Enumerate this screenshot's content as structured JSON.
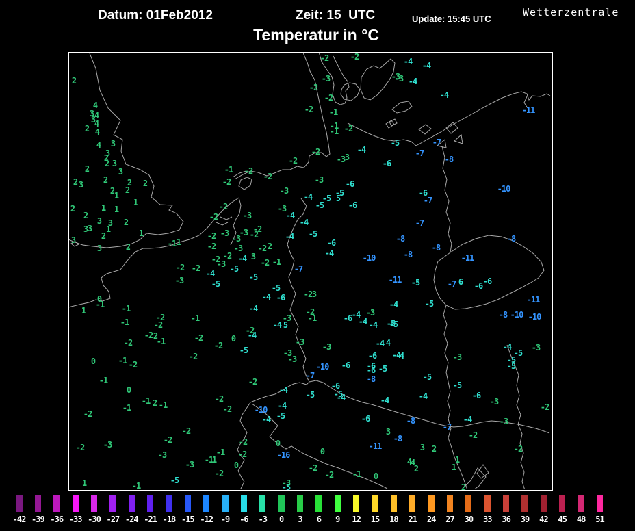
{
  "header": {
    "datum": "Datum: 01Feb2012",
    "zeit": "Zeit: 15  UTC",
    "update": "Update: 15:45 UTC",
    "brand": "Wetterzentrale",
    "title": "Temperatur in °C"
  },
  "map": {
    "colors": {
      "g": "#30c878",
      "c": "#30e0d0",
      "b": "#3494ff"
    },
    "stations": [
      [
        "2",
        108,
        118
      ],
      [
        "4",
        139,
        154
      ],
      [
        "3",
        134,
        166
      ],
      [
        "4",
        141,
        169
      ],
      [
        "3",
        136,
        175
      ],
      [
        "4",
        141,
        181
      ],
      [
        "2",
        127,
        188
      ],
      [
        "4",
        142,
        193
      ],
      [
        "4",
        144,
        212
      ],
      [
        "3",
        165,
        210
      ],
      [
        "3",
        157,
        224
      ],
      [
        "2",
        155,
        231
      ],
      [
        "2",
        156,
        239
      ],
      [
        "3",
        167,
        239
      ],
      [
        "3",
        176,
        251
      ],
      [
        "2",
        127,
        247
      ],
      [
        "2",
        110,
        266
      ],
      [
        "3",
        118,
        270
      ],
      [
        "2",
        154,
        263
      ],
      [
        "2",
        189,
        267
      ],
      [
        "2",
        212,
        268
      ],
      [
        "2",
        186,
        278
      ],
      [
        "2",
        164,
        279
      ],
      [
        "1",
        170,
        286
      ],
      [
        "2",
        106,
        305
      ],
      [
        "1",
        151,
        304
      ],
      [
        "1",
        170,
        306
      ],
      [
        "1",
        198,
        296
      ],
      [
        "2",
        125,
        315
      ],
      [
        "3",
        145,
        323
      ],
      [
        "3",
        161,
        326
      ],
      [
        "1",
        158,
        335
      ],
      [
        "3",
        125,
        335
      ],
      [
        "3",
        131,
        334
      ],
      [
        "2",
        151,
        345
      ],
      [
        "2",
        184,
        325
      ],
      [
        "1",
        206,
        341
      ],
      [
        "3",
        107,
        351
      ],
      [
        "3",
        145,
        363
      ],
      [
        "2",
        187,
        361
      ],
      [
        "-1",
        251,
        356
      ],
      [
        "1",
        261,
        354
      ],
      [
        "0",
        145,
        437
      ],
      [
        "-1",
        146,
        445
      ],
      [
        "1",
        122,
        454
      ],
      [
        "-1",
        184,
        451
      ],
      [
        "-1",
        182,
        471
      ],
      [
        "-2",
        234,
        464
      ],
      [
        "-2",
        231,
        475
      ],
      [
        "-2",
        217,
        490
      ],
      [
        "2",
        227,
        491
      ],
      [
        "-1",
        235,
        499
      ],
      [
        "-1",
        285,
        465
      ],
      [
        "-2",
        290,
        494
      ],
      [
        "-2",
        187,
        501
      ],
      [
        "-2",
        326,
        302
      ],
      [
        "-2",
        312,
        317
      ],
      [
        "-2",
        309,
        345
      ],
      [
        "-3",
        328,
        341
      ],
      [
        "-2",
        309,
        360
      ],
      [
        "-2",
        315,
        379
      ],
      [
        "-2",
        332,
        374
      ],
      [
        "-3",
        323,
        386
      ],
      [
        "-2",
        263,
        391
      ],
      [
        "-2",
        286,
        392
      ],
      [
        "-4",
        307,
        400,
        "c"
      ],
      [
        "-3",
        262,
        410
      ],
      [
        "-5",
        315,
        415,
        "c"
      ],
      [
        "-1",
        334,
        248
      ],
      [
        "-2",
        363,
        250
      ],
      [
        "-2",
        331,
        266
      ],
      [
        "-2",
        474,
        85
      ],
      [
        "-2",
        518,
        83
      ],
      [
        "-3",
        476,
        115
      ],
      [
        "-2",
        458,
        128
      ],
      [
        "-2",
        480,
        143
      ],
      [
        "-2",
        451,
        160
      ],
      [
        "-1",
        487,
        164
      ],
      [
        "-1",
        488,
        184
      ],
      [
        "-1",
        488,
        192
      ],
      [
        "-2",
        509,
        188
      ],
      [
        "-4",
        528,
        219,
        "c"
      ],
      [
        "-6",
        565,
        239,
        "c"
      ],
      [
        "-3",
        498,
        233
      ],
      [
        "3",
        507,
        230
      ],
      [
        "-2",
        461,
        222
      ],
      [
        "-2",
        428,
        235
      ],
      [
        "-2",
        391,
        258
      ],
      [
        "-3",
        466,
        263
      ],
      [
        "-6",
        511,
        269,
        "c"
      ],
      [
        "-3",
        415,
        279
      ],
      [
        "-4",
        450,
        288,
        "c"
      ],
      [
        "-5",
        496,
        282,
        "c"
      ],
      [
        "-5",
        477,
        290,
        "c"
      ],
      [
        "5",
        494,
        290,
        "c"
      ],
      [
        "-5",
        467,
        300,
        "c"
      ],
      [
        "-6",
        515,
        300,
        "c"
      ],
      [
        "-3",
        578,
        112
      ],
      [
        "-4",
        596,
        90,
        "c"
      ],
      [
        "-4",
        623,
        96,
        "c"
      ],
      [
        "-3",
        583,
        115
      ],
      [
        "-4",
        603,
        119,
        "c"
      ],
      [
        "-4",
        649,
        139,
        "c"
      ],
      [
        "-11",
        772,
        161,
        "b"
      ],
      [
        "-5",
        577,
        209,
        "c"
      ],
      [
        "-7",
        638,
        208,
        "b"
      ],
      [
        "-7",
        613,
        224,
        "b"
      ],
      [
        "-8",
        656,
        233,
        "b"
      ],
      [
        "-10",
        736,
        276,
        "b"
      ],
      [
        "-6",
        618,
        282,
        "c"
      ],
      [
        "-7",
        625,
        293,
        "b"
      ],
      [
        "-3",
        412,
        305
      ],
      [
        "-4",
        424,
        315,
        "c"
      ],
      [
        "-4",
        444,
        325,
        "c"
      ],
      [
        "-3",
        361,
        315
      ],
      [
        "-3",
        356,
        340
      ],
      [
        "-2",
        376,
        335
      ],
      [
        "-2",
        371,
        343
      ],
      [
        "-3",
        345,
        349
      ],
      [
        "-3",
        348,
        363
      ],
      [
        "-4",
        423,
        346,
        "c"
      ],
      [
        "-5",
        457,
        342,
        "c"
      ],
      [
        "-6",
        484,
        355,
        "c"
      ],
      [
        "-4",
        481,
        370,
        "c"
      ],
      [
        "-10",
        539,
        377,
        "b"
      ],
      [
        "-2",
        383,
        363
      ],
      [
        "2",
        394,
        360
      ],
      [
        "-4",
        354,
        378,
        "c"
      ],
      [
        "3",
        370,
        375
      ],
      [
        "-5",
        342,
        393,
        "c"
      ],
      [
        "-2",
        387,
        384
      ],
      [
        "-1",
        404,
        383
      ],
      [
        "-7",
        436,
        393,
        "b"
      ],
      [
        "-5",
        370,
        405,
        "c"
      ],
      [
        "-5",
        403,
        421,
        "c"
      ],
      [
        "-4",
        389,
        434,
        "c"
      ],
      [
        "-6",
        410,
        435,
        "c"
      ],
      [
        "-2",
        450,
        430
      ],
      [
        "3",
        459,
        430
      ],
      [
        "-4",
        370,
        451,
        "c"
      ],
      [
        "-2",
        453,
        456
      ],
      [
        "-1",
        456,
        465
      ],
      [
        "-3",
        419,
        465
      ],
      [
        "-4",
        405,
        475,
        "c"
      ],
      [
        "5",
        417,
        475,
        "c"
      ],
      [
        "-2",
        365,
        483
      ],
      [
        "-4",
        368,
        490,
        "c"
      ],
      [
        "0",
        341,
        495
      ],
      [
        "-3",
        438,
        500
      ],
      [
        "-6",
        508,
        465,
        "c"
      ],
      [
        "-4",
        520,
        460,
        "c"
      ],
      [
        "-3",
        541,
        457
      ],
      [
        "-4",
        530,
        470,
        "c"
      ],
      [
        "-4",
        545,
        475,
        "c"
      ],
      [
        "-5",
        571,
        473,
        "c"
      ],
      [
        "-4",
        575,
        445,
        "c"
      ],
      [
        "-4",
        555,
        502,
        "c"
      ],
      [
        "4",
        567,
        501,
        "c"
      ],
      [
        "-11",
        577,
        409,
        "b"
      ],
      [
        "-7",
        613,
        326,
        "b"
      ],
      [
        "-8",
        585,
        349,
        "b"
      ],
      [
        "-8",
        637,
        362,
        "b"
      ],
      [
        "-8",
        596,
        372,
        "b"
      ],
      [
        "-8",
        747,
        349,
        "b"
      ],
      [
        "-11",
        683,
        377,
        "b"
      ],
      [
        "-5",
        607,
        413,
        "c"
      ],
      [
        "-7",
        660,
        415,
        "b"
      ],
      [
        "6",
        673,
        412,
        "c"
      ],
      [
        "-6",
        699,
        418,
        "c"
      ],
      [
        "-6",
        712,
        411,
        "c"
      ],
      [
        "-11",
        779,
        438,
        "b"
      ],
      [
        "-5",
        627,
        444,
        "c"
      ],
      [
        "-5",
        575,
        474,
        "c"
      ],
      [
        "-8",
        735,
        460,
        "b"
      ],
      [
        "-10",
        755,
        460,
        "b"
      ],
      [
        "-10",
        781,
        463,
        "b"
      ],
      [
        "-2",
        319,
        505
      ],
      [
        "-2",
        282,
        521
      ],
      [
        "0",
        136,
        528
      ],
      [
        "-1",
        179,
        527
      ],
      [
        "-2",
        194,
        533
      ],
      [
        "-1",
        151,
        556
      ],
      [
        "0",
        188,
        570
      ],
      [
        "-1",
        213,
        586
      ],
      [
        "2",
        226,
        589
      ],
      [
        "-1",
        238,
        592
      ],
      [
        "-1",
        185,
        596
      ],
      [
        "-2",
        128,
        605
      ],
      [
        "-2",
        320,
        583
      ],
      [
        "-2",
        332,
        598
      ],
      [
        "-2",
        272,
        630
      ],
      [
        "-2",
        245,
        643
      ],
      [
        "-3",
        157,
        650
      ],
      [
        "-2",
        117,
        654
      ],
      [
        "-3",
        237,
        665
      ],
      [
        "-1",
        322,
        661
      ],
      [
        "-1",
        305,
        672
      ],
      [
        "1",
        313,
        672
      ],
      [
        "-3",
        277,
        679
      ],
      [
        "-2",
        320,
        692
      ],
      [
        "-5",
        255,
        702,
        "c"
      ],
      [
        "-1",
        199,
        710
      ],
      [
        "1",
        123,
        706
      ],
      [
        "-5",
        356,
        512,
        "c"
      ],
      [
        "-3",
        420,
        516
      ],
      [
        "-3",
        427,
        525
      ],
      [
        "-3",
        477,
        507
      ],
      [
        "-10",
        471,
        536,
        "b"
      ],
      [
        "-6",
        505,
        534,
        "c"
      ],
      [
        "-7",
        453,
        549,
        "b"
      ],
      [
        "-6",
        544,
        520,
        "c"
      ],
      [
        "-6",
        542,
        535,
        "c"
      ],
      [
        "-6",
        542,
        541,
        "c"
      ],
      [
        "-5",
        559,
        539,
        "c"
      ],
      [
        "-8",
        542,
        554,
        "b"
      ],
      [
        "-2",
        369,
        558
      ],
      [
        "-4",
        414,
        570,
        "c"
      ],
      [
        "-5",
        453,
        577,
        "c"
      ],
      [
        "-6",
        490,
        564,
        "c"
      ],
      [
        "-5",
        494,
        576,
        "c"
      ],
      [
        "-4",
        498,
        581,
        "c"
      ],
      [
        "-4",
        562,
        585,
        "c"
      ],
      [
        "-4",
        412,
        593,
        "c"
      ],
      [
        "-10",
        381,
        599,
        "b"
      ],
      [
        "-5",
        410,
        608,
        "c"
      ],
      [
        "-4",
        389,
        613,
        "c"
      ],
      [
        "-6",
        534,
        612,
        "c"
      ],
      [
        "3",
        567,
        631
      ],
      [
        "-11",
        548,
        652,
        "b"
      ],
      [
        "-2",
        355,
        646
      ],
      [
        "0",
        406,
        648
      ],
      [
        "-2",
        354,
        664
      ],
      [
        "0",
        345,
        680
      ],
      [
        "-16",
        414,
        665,
        "b"
      ],
      [
        "0",
        471,
        660
      ],
      [
        "-2",
        457,
        684
      ],
      [
        "-2",
        481,
        694
      ],
      [
        "-1",
        521,
        693
      ],
      [
        "0",
        549,
        696
      ],
      [
        "-3",
        418,
        706
      ],
      [
        "-5",
        418,
        712,
        "c"
      ],
      [
        "-4",
        579,
        519,
        "c"
      ],
      [
        "4",
        587,
        520,
        "c"
      ],
      [
        "-3",
        668,
        522
      ],
      [
        "-4",
        741,
        507,
        "c"
      ],
      [
        "-3",
        783,
        508
      ],
      [
        "-5",
        757,
        516,
        "c"
      ],
      [
        "-5",
        747,
        526,
        "c"
      ],
      [
        "-5",
        747,
        535,
        "c"
      ],
      [
        "-5",
        624,
        551,
        "c"
      ],
      [
        "-5",
        668,
        563,
        "c"
      ],
      [
        "-4",
        618,
        579,
        "c"
      ],
      [
        "-6",
        696,
        578,
        "c"
      ],
      [
        "-3",
        722,
        587
      ],
      [
        "-2",
        796,
        595
      ],
      [
        "-8",
        600,
        615,
        "b"
      ],
      [
        "-4",
        683,
        613,
        "c"
      ],
      [
        "-7",
        653,
        624,
        "b"
      ],
      [
        "-3",
        736,
        616
      ],
      [
        "-2",
        691,
        636
      ],
      [
        "-8",
        581,
        641,
        "b"
      ],
      [
        "-2",
        757,
        656
      ],
      [
        "3",
        617,
        654
      ],
      [
        "2",
        634,
        656
      ],
      [
        "4",
        598,
        675
      ],
      [
        "4",
        603,
        676
      ],
      [
        "2",
        608,
        685
      ],
      [
        "1",
        668,
        672
      ],
      [
        "1",
        663,
        683
      ],
      [
        "2",
        677,
        712
      ]
    ]
  },
  "colorbar": {
    "values": [
      -42,
      -39,
      -36,
      -33,
      -30,
      -27,
      -24,
      -21,
      -18,
      -15,
      -12,
      -9,
      -6,
      -3,
      0,
      3,
      6,
      9,
      12,
      15,
      18,
      21,
      24,
      27,
      30,
      33,
      36,
      39,
      42,
      45,
      48,
      51
    ],
    "colors": [
      "#7a1880",
      "#941894",
      "#bc18bc",
      "#f818f8",
      "#d828e8",
      "#a020f0",
      "#8020f0",
      "#6020f0",
      "#4030f0",
      "#2858f8",
      "#1c86ff",
      "#28b0f8",
      "#28dce8",
      "#28e0a8",
      "#20c458",
      "#28cc48",
      "#28e038",
      "#40ff40",
      "#f8f828",
      "#ffd828",
      "#ffc028",
      "#ffac28",
      "#ff9820",
      "#f28420",
      "#e66c18",
      "#dc5430",
      "#c84038",
      "#b03030",
      "#a02030",
      "#bc2050",
      "#d42874",
      "#ff28a0"
    ]
  }
}
